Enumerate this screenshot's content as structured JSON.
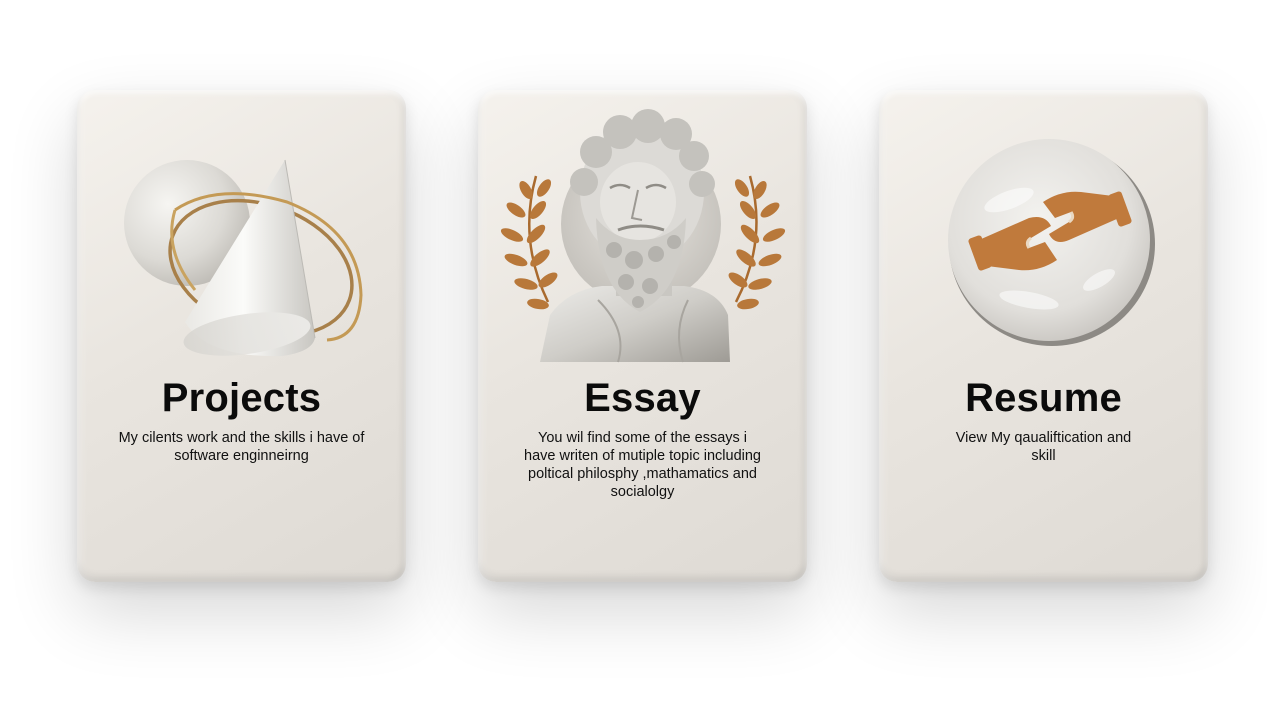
{
  "cards": [
    {
      "id": "projects",
      "title": "Projects",
      "description": "My cilents work and the skills i have of software enginneirng",
      "illustration": "cone-sphere-ring-icon"
    },
    {
      "id": "essay",
      "title": "Essay",
      "description": "You wil find some of the essays i have writen of mutiple topic including poltical philosphy ,mathamatics and socialolgy",
      "illustration": "philosopher-bust-icon"
    },
    {
      "id": "resume",
      "title": "Resume",
      "description": "View My qaualiftication and skill",
      "illustration": "handshake-icon"
    }
  ],
  "colors": {
    "card_light": "#f5f2ed",
    "card_dark": "#dedad4",
    "laurel_gold": "#b8783a",
    "handshake_copper": "#c07a3c",
    "ring_gold": "#b8904a",
    "text": "#0b0b0b"
  }
}
